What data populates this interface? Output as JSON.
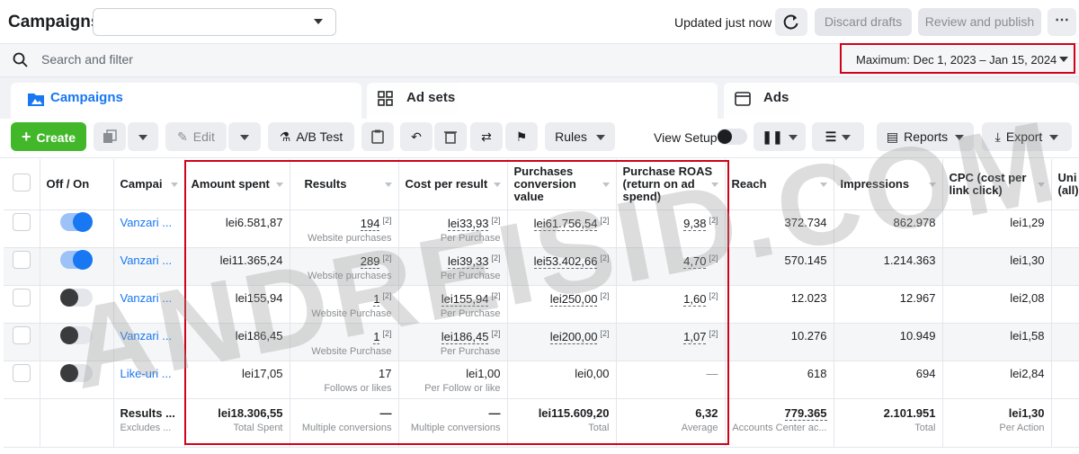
{
  "header": {
    "title": "Campaigns",
    "updated": "Updated just now",
    "discard": "Discard drafts",
    "review": "Review and publish",
    "more": "⋯"
  },
  "search": {
    "placeholder": "Search and filter",
    "date_range": "Maximum: Dec 1, 2023 – Jan 15, 2024"
  },
  "tabs": [
    {
      "label": "Campaigns"
    },
    {
      "label": "Ad sets"
    },
    {
      "label": "Ads"
    }
  ],
  "toolbar": {
    "create": "Create",
    "edit": "Edit",
    "ab_test": "A/B Test",
    "rules": "Rules",
    "view_setup": "View Setup",
    "reports": "Reports",
    "export": "Export"
  },
  "columns": {
    "off_on": "Off / On",
    "campaign": "Campai",
    "amount": "Amount spent",
    "results": "Results",
    "cost": "Cost per result",
    "pcv": "Purchases conversion value",
    "roas": "Purchase ROAS (return on ad spend)",
    "reach": "Reach",
    "impressions": "Impressions",
    "cpc": "CPC (cost per link click)",
    "uni": "Uni (all)"
  },
  "rows": [
    {
      "on": true,
      "name": "Vanzari ...",
      "amount": "lei6.581,87",
      "results": "194",
      "results_sub": "Website purchases",
      "cost": "lei33,93",
      "cost_sub": "Per Purchase",
      "pcv": "lei61.756,54",
      "roas": "9,38",
      "reach": "372.734",
      "impressions": "862.978",
      "cpc": "lei1,29"
    },
    {
      "on": true,
      "name": "Vanzari ...",
      "amount": "lei11.365,24",
      "results": "289",
      "results_sub": "Website purchases",
      "cost": "lei39,33",
      "cost_sub": "Per Purchase",
      "pcv": "lei53.402,66",
      "roas": "4,70",
      "reach": "570.145",
      "impressions": "1.214.363",
      "cpc": "lei1,30"
    },
    {
      "on": false,
      "name": "Vanzari ...",
      "amount": "lei155,94",
      "results": "1",
      "results_sub": "Website Purchase",
      "cost": "lei155,94",
      "cost_sub": "Per Purchase",
      "pcv": "lei250,00",
      "roas": "1,60",
      "reach": "12.023",
      "impressions": "12.967",
      "cpc": "lei2,08"
    },
    {
      "on": false,
      "name": "Vanzari ...",
      "amount": "lei186,45",
      "results": "1",
      "results_sub": "Website Purchase",
      "cost": "lei186,45",
      "cost_sub": "Per Purchase",
      "pcv": "lei200,00",
      "roas": "1,07",
      "reach": "10.276",
      "impressions": "10.949",
      "cpc": "lei1,58"
    },
    {
      "on": false,
      "name": "Like-uri ...",
      "amount": "lei17,05",
      "results": "17",
      "results_sub": "Follows or likes",
      "cost": "lei1,00",
      "cost_sub": "Per Follow or like",
      "pcv": "lei0,00",
      "roas": "—",
      "reach": "618",
      "impressions": "694",
      "cpc": "lei2,84"
    }
  ],
  "footnote": "[2]",
  "totals": {
    "label": "Results ...",
    "label_sub": "Excludes ...",
    "amount": "lei18.306,55",
    "amount_sub": "Total Spent",
    "results": "—",
    "results_sub": "Multiple conversions",
    "cost": "—",
    "cost_sub": "Multiple conversions",
    "pcv": "lei115.609,20",
    "pcv_sub": "Total",
    "roas": "6,32",
    "roas_sub": "Average",
    "reach": "779.365",
    "reach_sub": "Accounts Center ac...",
    "impressions": "2.101.951",
    "impressions_sub": "Total",
    "cpc": "lei1,30",
    "cpc_sub": "Per Action"
  },
  "watermark": "ANDREISID.COM"
}
